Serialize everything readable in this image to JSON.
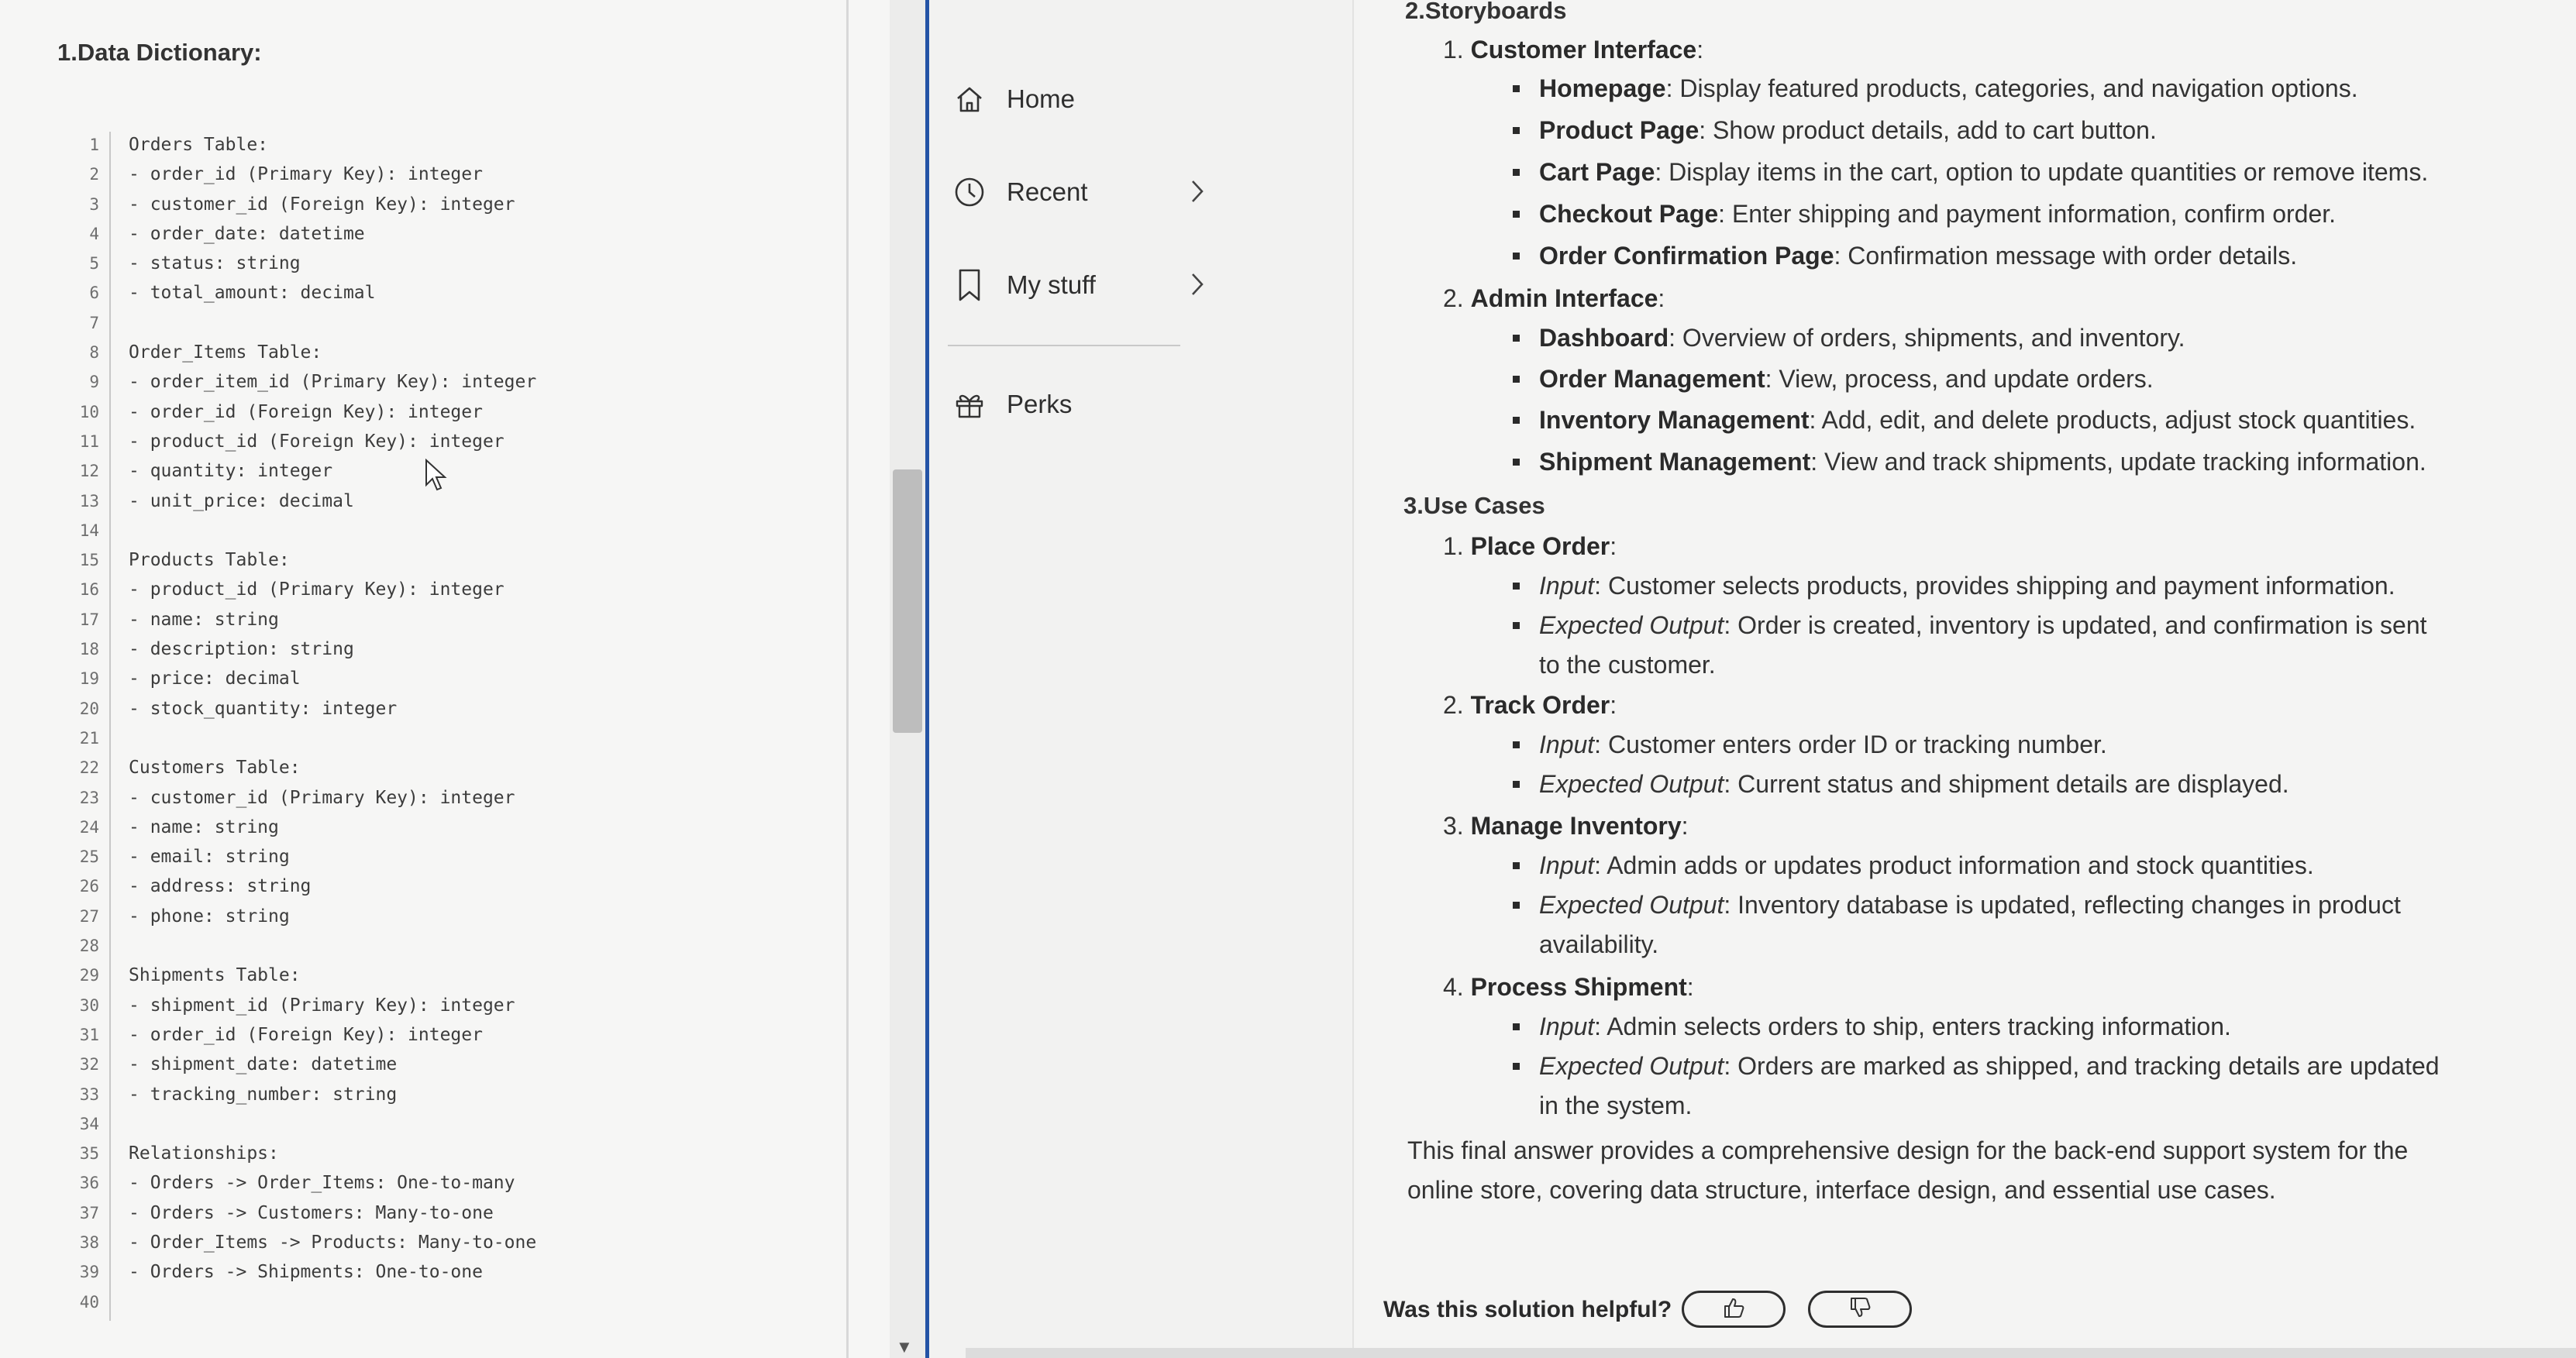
{
  "data_dictionary": {
    "title": "1.Data Dictionary:",
    "lines": [
      {
        "n": "1",
        "text": "Orders Table:"
      },
      {
        "n": "2",
        "text": "- order_id (Primary Key): integer"
      },
      {
        "n": "3",
        "text": "- customer_id (Foreign Key): integer"
      },
      {
        "n": "4",
        "text": "- order_date: datetime"
      },
      {
        "n": "5",
        "text": "- status: string"
      },
      {
        "n": "6",
        "text": "- total_amount: decimal"
      },
      {
        "n": "7",
        "text": ""
      },
      {
        "n": "8",
        "text": "Order_Items Table:"
      },
      {
        "n": "9",
        "text": "- order_item_id (Primary Key): integer"
      },
      {
        "n": "10",
        "text": "- order_id (Foreign Key): integer"
      },
      {
        "n": "11",
        "text": "- product_id (Foreign Key): integer"
      },
      {
        "n": "12",
        "text": "- quantity: integer"
      },
      {
        "n": "13",
        "text": "- unit_price: decimal"
      },
      {
        "n": "14",
        "text": ""
      },
      {
        "n": "15",
        "text": "Products Table:"
      },
      {
        "n": "16",
        "text": "- product_id (Primary Key): integer"
      },
      {
        "n": "17",
        "text": "- name: string"
      },
      {
        "n": "18",
        "text": "- description: string"
      },
      {
        "n": "19",
        "text": "- price: decimal"
      },
      {
        "n": "20",
        "text": "- stock_quantity: integer"
      },
      {
        "n": "21",
        "text": ""
      },
      {
        "n": "22",
        "text": "Customers Table:"
      },
      {
        "n": "23",
        "text": "- customer_id (Primary Key): integer"
      },
      {
        "n": "24",
        "text": "- name: string"
      },
      {
        "n": "25",
        "text": "- email: string"
      },
      {
        "n": "26",
        "text": "- address: string"
      },
      {
        "n": "27",
        "text": "- phone: string"
      },
      {
        "n": "28",
        "text": ""
      },
      {
        "n": "29",
        "text": "Shipments Table:"
      },
      {
        "n": "30",
        "text": "- shipment_id (Primary Key): integer"
      },
      {
        "n": "31",
        "text": "- order_id (Foreign Key): integer"
      },
      {
        "n": "32",
        "text": "- shipment_date: datetime"
      },
      {
        "n": "33",
        "text": "- tracking_number: string"
      },
      {
        "n": "34",
        "text": ""
      },
      {
        "n": "35",
        "text": "Relationships:"
      },
      {
        "n": "36",
        "text": "- Orders -> Order_Items: One-to-many"
      },
      {
        "n": "37",
        "text": "- Orders -> Customers: Many-to-one"
      },
      {
        "n": "38",
        "text": "- Order_Items -> Products: Many-to-one"
      },
      {
        "n": "39",
        "text": "- Orders -> Shipments: One-to-one"
      },
      {
        "n": "40",
        "text": ""
      }
    ]
  },
  "nav": {
    "items": [
      {
        "label": "Home",
        "icon": "home-icon"
      },
      {
        "label": "Recent",
        "icon": "clock-icon"
      },
      {
        "label": "My stuff",
        "icon": "bookmark-icon"
      },
      {
        "label": "Perks",
        "icon": "gift-icon"
      }
    ]
  },
  "storyboards": {
    "title": "2.Storyboards",
    "customer_heading_num": "1.",
    "customer_heading": "Customer Interface",
    "customer": [
      {
        "term": "Homepage",
        "desc": ": Display featured products, categories, and navigation options."
      },
      {
        "term": "Product Page",
        "desc": ": Show product details, add to cart button."
      },
      {
        "term": "Cart Page",
        "desc": ": Display items in the cart, option to update quantities or remove items."
      },
      {
        "term": "Checkout Page",
        "desc": ": Enter shipping and payment information, confirm order."
      },
      {
        "term": "Order Confirmation Page",
        "desc": ": Confirmation message with order details."
      }
    ],
    "admin_heading_num": "2.",
    "admin_heading": "Admin Interface",
    "admin": [
      {
        "term": "Dashboard",
        "desc": ": Overview of orders, shipments, and inventory."
      },
      {
        "term": "Order Management",
        "desc": ": View, process, and update orders."
      },
      {
        "term": "Inventory Management",
        "desc": ": Add, edit, and delete products, adjust stock quantities."
      },
      {
        "term": "Shipment Management",
        "desc": ": View and track shipments, update tracking information."
      }
    ]
  },
  "use_cases": {
    "title": "3.Use Cases",
    "items": [
      {
        "num": "1.",
        "name": "Place Order",
        "input": "Customer selects products, provides shipping and payment information.",
        "output_1": "Order is created, inventory is updated, and confirmation is sent",
        "output_2": "to the customer."
      },
      {
        "num": "2.",
        "name": "Track Order",
        "input": "Customer enters order ID or tracking number.",
        "output_1": "Current status and shipment details are displayed.",
        "output_2": ""
      },
      {
        "num": "3.",
        "name": "Manage Inventory",
        "input": "Admin adds or updates product information and stock quantities.",
        "output_1": "Inventory database is updated, reflecting changes in product",
        "output_2": "availability."
      },
      {
        "num": "4.",
        "name": "Process Shipment",
        "input": "Admin selects orders to ship, enters tracking information.",
        "output_1": "Orders are marked as shipped, and tracking details are updated",
        "output_2": "in the system."
      }
    ],
    "input_label": "Input",
    "output_label": "Expected Output",
    "colon": ":"
  },
  "summary": {
    "line_1": "This final answer provides a comprehensive design for the back-end support system for the",
    "line_2": "online store, covering data structure, interface design, and essential use cases."
  },
  "feedback": {
    "question": "Was this solution helpful?"
  }
}
